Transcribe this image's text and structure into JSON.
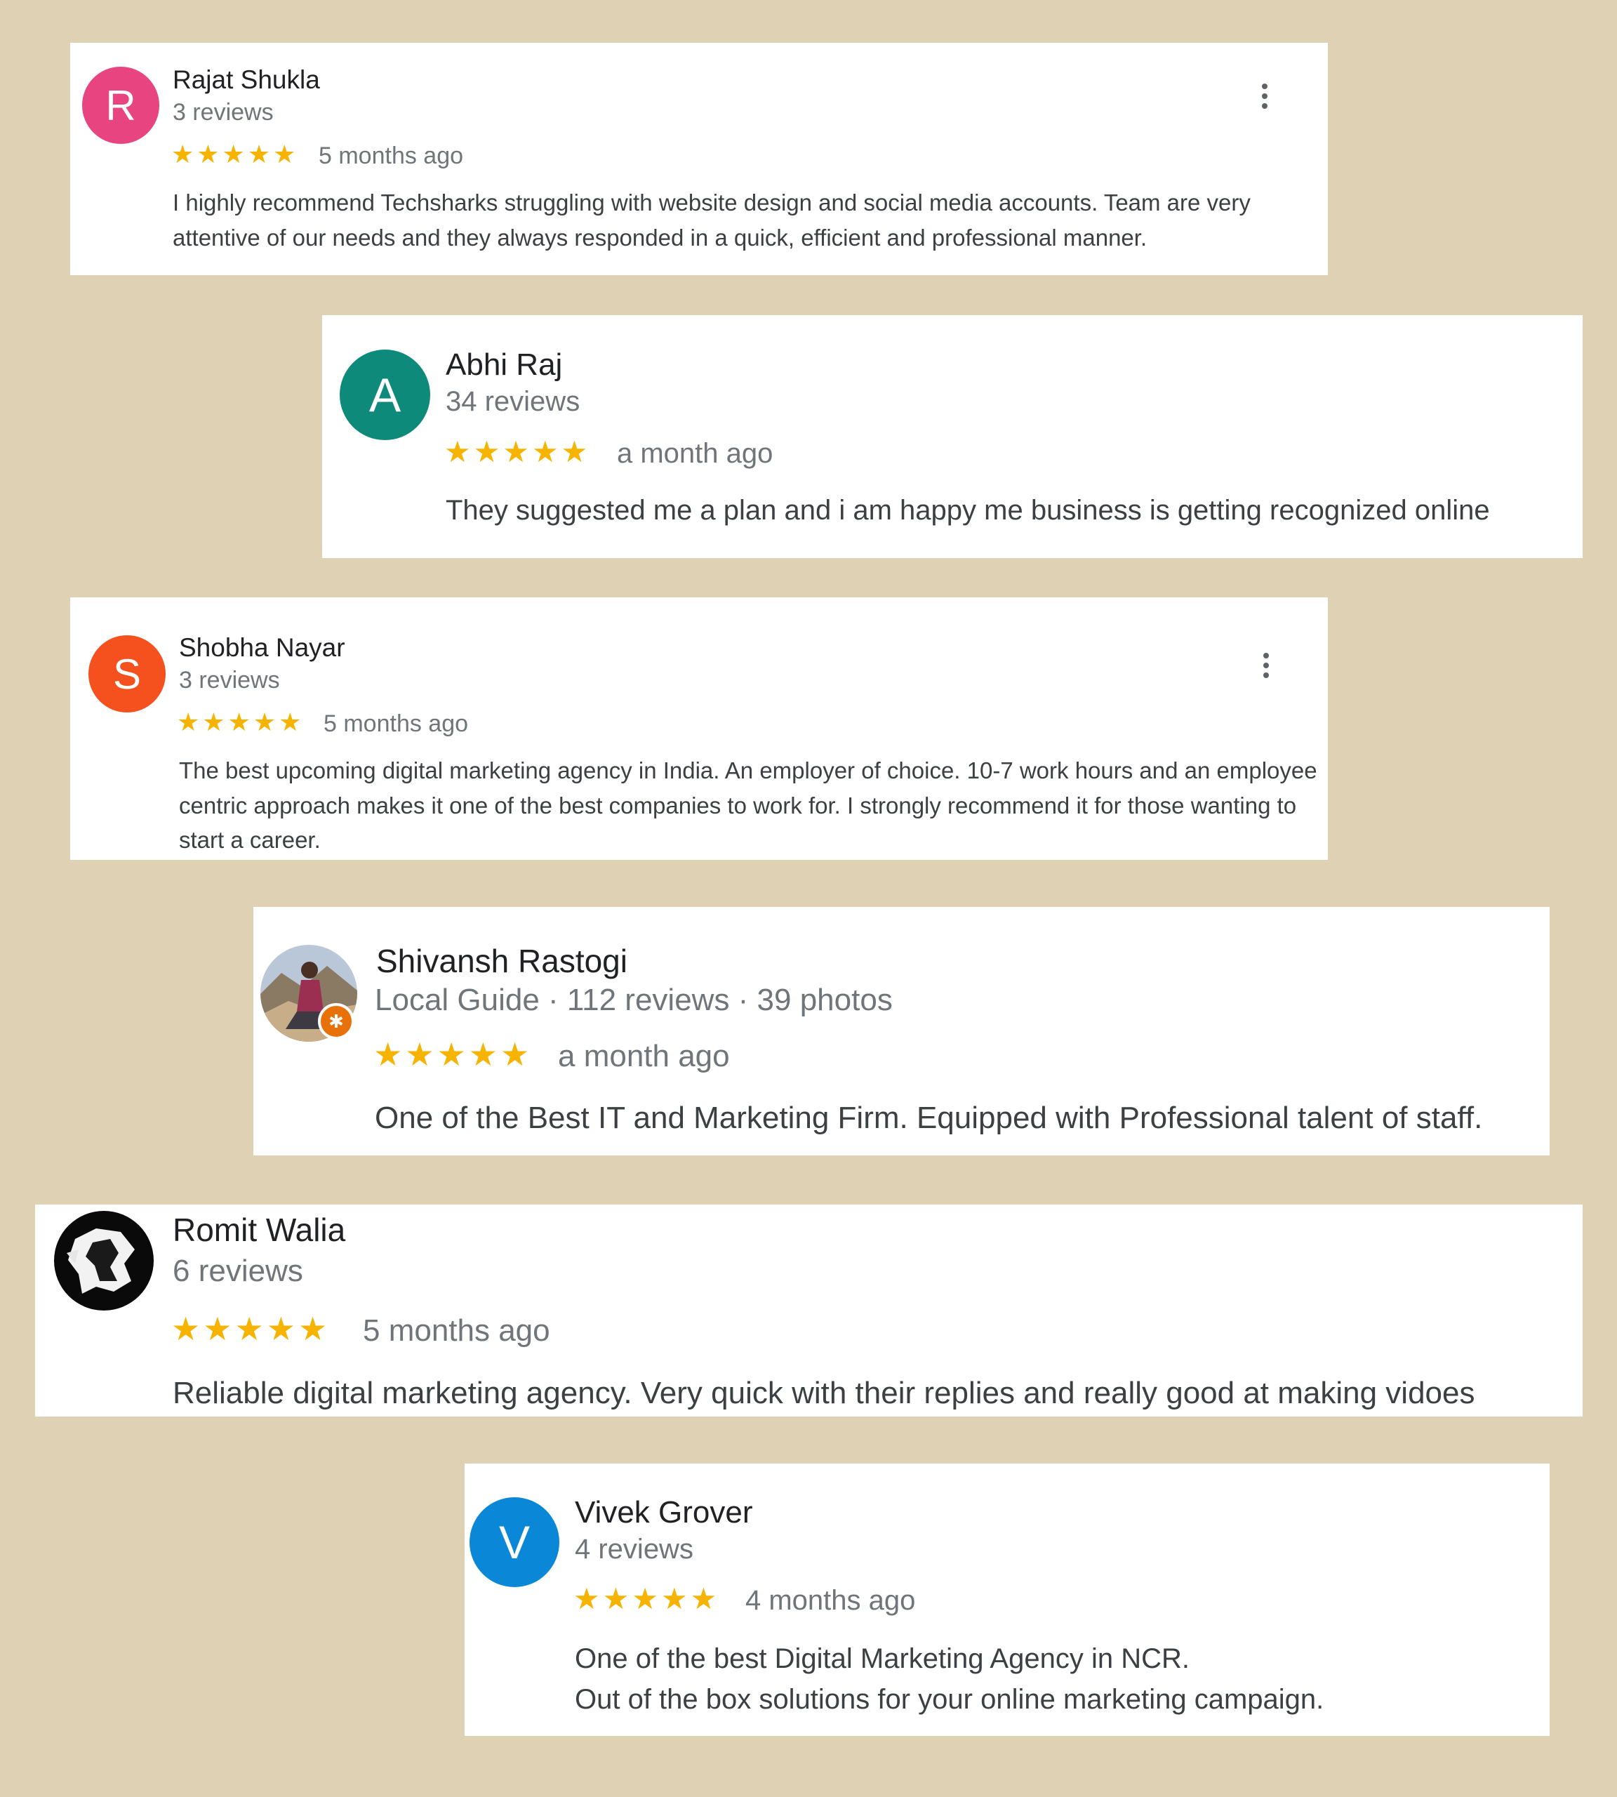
{
  "colors": {
    "background": "#dfd1b4",
    "star": "#f6b400",
    "avatar_rajat": "#e8447f",
    "avatar_abhi": "#0e8a7a",
    "avatar_shobha": "#f4511e",
    "avatar_vivek": "#0b87d8",
    "badge": "#e8710a"
  },
  "reviews": [
    {
      "initial": "R",
      "name": "Rajat Shukla",
      "meta": "3 reviews",
      "rating": 5,
      "stars": "★★★★★",
      "time": "5 months ago",
      "text": "I highly recommend Techsharks struggling with website design and social media accounts.   Team are very attentive of our needs and they always responded in a quick, efficient and professional manner.",
      "menu_icon": "more-vertical-icon"
    },
    {
      "initial": "A",
      "name": "Abhi Raj",
      "meta": "34 reviews",
      "rating": 5,
      "stars": "★★★★★",
      "time": "a month ago",
      "text": "They suggested me a plan and i am happy me business is getting recognized online"
    },
    {
      "initial": "S",
      "name": "Shobha Nayar",
      "meta": "3 reviews",
      "rating": 5,
      "stars": "★★★★★",
      "time": "5 months ago",
      "text": "The best upcoming digital marketing agency in India. An employer of choice. 10-7 work hours and an employee centric approach makes it one of the best companies to work for. I strongly recommend it for those wanting to start a career.",
      "menu_icon": "more-vertical-icon"
    },
    {
      "name": "Shivansh Rastogi",
      "meta": "Local Guide · 112 reviews · 39 photos",
      "badge_icon": "local-guide-star-icon",
      "badge_glyph": "✱",
      "rating": 5,
      "stars": "★★★★★",
      "time": "a month ago",
      "text": "One of the Best IT and Marketing Firm. Equipped with Professional talent of staff."
    },
    {
      "name": "Romit Walia",
      "meta": "6 reviews",
      "rating": 5,
      "stars": "★★★★★",
      "time": "5 months ago",
      "text": "Reliable digital marketing agency. Very quick with their replies and really good at making vidoes"
    },
    {
      "initial": "V",
      "name": "Vivek Grover",
      "meta": "4 reviews",
      "rating": 5,
      "stars": "★★★★★",
      "time": "4 months ago",
      "text_line1": "One of the best Digital Marketing Agency in NCR.",
      "text_line2": "Out of the box solutions for your online marketing campaign."
    }
  ]
}
